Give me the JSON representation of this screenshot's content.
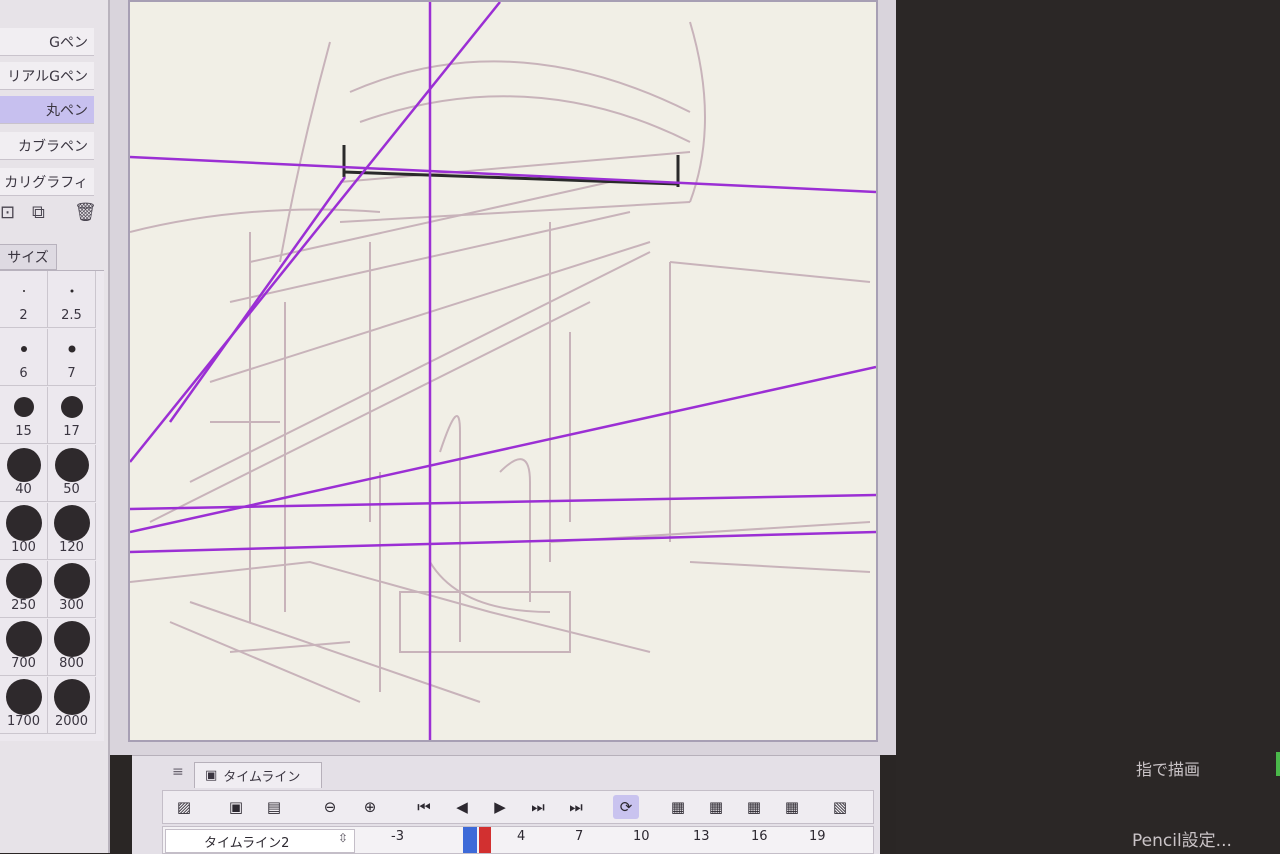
{
  "brushes": {
    "items": [
      {
        "label": "Gペン"
      },
      {
        "label": "リアルGペン"
      },
      {
        "label": "丸ペン",
        "selected": true
      },
      {
        "label": "カブラペン"
      },
      {
        "label": "カリグラフィ"
      }
    ]
  },
  "brush_size": {
    "tab_label": "サイズ",
    "sizes": [
      "2",
      "2.5",
      "6",
      "7",
      "15",
      "17",
      "40",
      "50",
      "100",
      "120",
      "250",
      "300",
      "700",
      "800",
      "1700",
      "2000"
    ]
  },
  "timeline": {
    "tab_label": "タイムライン",
    "selected_timeline": "タイムライン2",
    "frames": [
      "-3",
      "4",
      "7",
      "10",
      "13",
      "16",
      "19"
    ]
  },
  "right_panel": {
    "finger_draw": "指で描画",
    "pencil_settings": "Pencil設定..."
  },
  "colors": {
    "perspective_line": "#9b2fd4",
    "sketch": "#b79aa8",
    "selection_accent": "#c7c0ef",
    "playhead": "#3d6ad8"
  }
}
